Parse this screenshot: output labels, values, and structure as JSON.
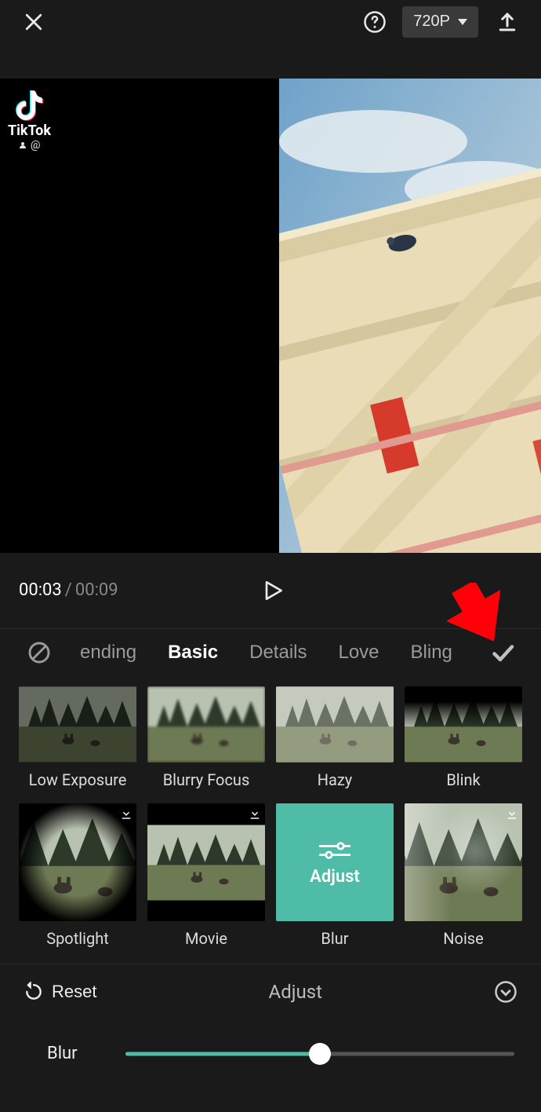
{
  "header": {
    "resolution_label": "720P"
  },
  "watermark": {
    "brand": "TikTok",
    "user": "@"
  },
  "playback": {
    "current_time": "00:03",
    "duration": "00:09"
  },
  "tabs": {
    "items": [
      "ending",
      "Basic",
      "Details",
      "Love",
      "Bling"
    ],
    "active_index": 1
  },
  "effects_row1": [
    {
      "name": "Low Exposure",
      "downloadable": false
    },
    {
      "name": "Blurry Focus",
      "downloadable": false
    },
    {
      "name": "Hazy",
      "downloadable": false
    },
    {
      "name": "Blink",
      "downloadable": false
    }
  ],
  "effects_row2": [
    {
      "name": "Spotlight",
      "downloadable": true
    },
    {
      "name": "Movie",
      "downloadable": true
    },
    {
      "name": "Blur",
      "downloadable": false,
      "adjust_tile": true,
      "adjust_text": "Adjust"
    },
    {
      "name": "Noise",
      "downloadable": true
    }
  ],
  "adjust_panel": {
    "reset_label": "Reset",
    "title": "Adjust",
    "slider_label": "Blur",
    "slider_percent": 50
  },
  "colors": {
    "accent": "#4fbca8",
    "annotation_arrow": "#ff0008"
  }
}
